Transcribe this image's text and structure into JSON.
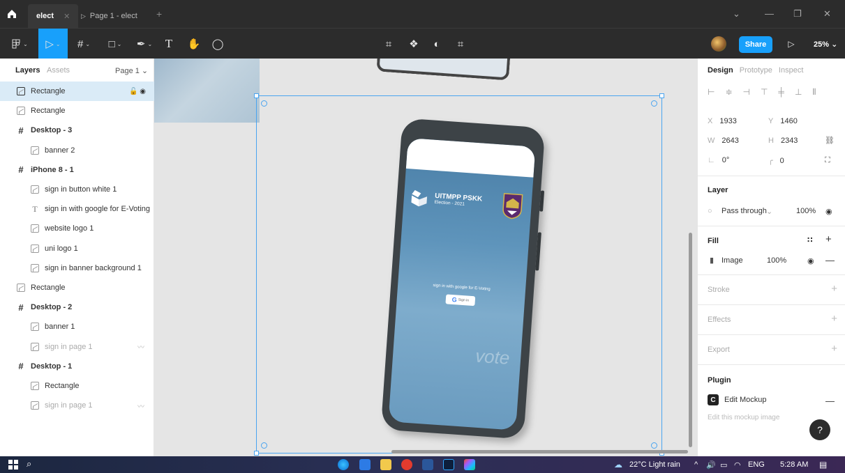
{
  "titlebar": {
    "tabs": [
      {
        "label": "elect",
        "active": true
      },
      {
        "label": "Page 1 - elect",
        "active": false
      }
    ],
    "window_controls": [
      "⌄",
      "—",
      "❐",
      "✕"
    ]
  },
  "toolbar": {
    "share_label": "Share",
    "zoom": "25%",
    "zoom_caret": "⌄"
  },
  "left_panel": {
    "tabs": {
      "layers": "Layers",
      "assets": "Assets"
    },
    "page_selector": "Page 1 ⌄",
    "layers": [
      {
        "name": "Rectangle",
        "type": "image",
        "indent": 0,
        "selected": true,
        "dim": false
      },
      {
        "name": "Rectangle",
        "type": "image",
        "indent": 0,
        "selected": false,
        "dim": false
      },
      {
        "name": "Desktop - 3",
        "type": "frame",
        "indent": 0,
        "selected": false,
        "dim": false
      },
      {
        "name": "banner 2",
        "type": "image",
        "indent": 1,
        "selected": false,
        "dim": false
      },
      {
        "name": "iPhone 8 - 1",
        "type": "frame",
        "indent": 0,
        "selected": false,
        "dim": false
      },
      {
        "name": "sign in button white 1",
        "type": "image",
        "indent": 1,
        "selected": false,
        "dim": false
      },
      {
        "name": "sign in with google for E-Voting",
        "type": "text",
        "indent": 1,
        "selected": false,
        "dim": false
      },
      {
        "name": "website logo 1",
        "type": "image",
        "indent": 1,
        "selected": false,
        "dim": false
      },
      {
        "name": "uni logo 1",
        "type": "image",
        "indent": 1,
        "selected": false,
        "dim": false
      },
      {
        "name": "sign in banner background 1",
        "type": "image",
        "indent": 1,
        "selected": false,
        "dim": false
      },
      {
        "name": "Rectangle",
        "type": "image",
        "indent": 0,
        "selected": false,
        "dim": false
      },
      {
        "name": "Desktop - 2",
        "type": "frame",
        "indent": 0,
        "selected": false,
        "dim": false
      },
      {
        "name": "banner 1",
        "type": "image",
        "indent": 1,
        "selected": false,
        "dim": false
      },
      {
        "name": "sign in page 1",
        "type": "image",
        "indent": 1,
        "selected": false,
        "dim": true
      },
      {
        "name": "Desktop - 1",
        "type": "frame",
        "indent": 0,
        "selected": false,
        "dim": false
      },
      {
        "name": "Rectangle",
        "type": "image",
        "indent": 1,
        "selected": false,
        "dim": false
      },
      {
        "name": "sign in page 1",
        "type": "image",
        "indent": 1,
        "selected": false,
        "dim": true
      }
    ]
  },
  "canvas": {
    "mockup": {
      "brand_title": "UITMPP PSKK",
      "brand_subtitle": "Election - 2021",
      "signin_text": "sign in with google for E-Voting",
      "google_button": "Sign in",
      "google_glyph": "G",
      "watermark": "vote"
    }
  },
  "right_panel": {
    "tabs": {
      "design": "Design",
      "prototype": "Prototype",
      "inspect": "Inspect"
    },
    "x": {
      "label": "X",
      "value": "1933"
    },
    "y": {
      "label": "Y",
      "value": "1460"
    },
    "w": {
      "label": "W",
      "value": "2643"
    },
    "h": {
      "label": "H",
      "value": "2343"
    },
    "rotation": "0°",
    "radius": "0",
    "layer": {
      "title": "Layer",
      "blend": "Pass through",
      "opacity": "100%"
    },
    "fill": {
      "title": "Fill",
      "type": "Image",
      "opacity": "100%"
    },
    "stroke": {
      "title": "Stroke"
    },
    "effects": {
      "title": "Effects"
    },
    "export": {
      "title": "Export"
    },
    "plugin": {
      "title": "Plugin",
      "name": "Edit Mockup",
      "hint": "Edit this mockup image",
      "icon_letter": "C"
    },
    "help": "?"
  },
  "taskbar": {
    "weather": "22°C  Light rain",
    "language": "ENG",
    "time": "5:28 AM"
  },
  "colors": {
    "accent": "#18a0fb",
    "chrome": "#2c2c2c",
    "selection_row": "#daebf7"
  }
}
